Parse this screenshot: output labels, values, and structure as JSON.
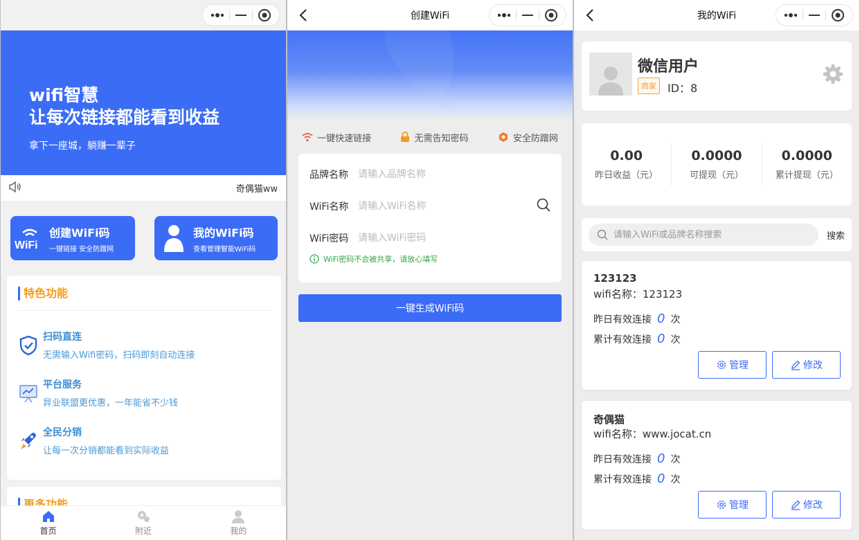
{
  "home": {
    "hero": {
      "line1": "wifi智慧",
      "line2": "让每次链接都能看到收益",
      "sub": "拿下一座城，躺赚一辈子"
    },
    "notice": "奇偶猫ww",
    "quick": [
      {
        "title": "创建WiFi码",
        "sub": "一键链接 安全防蹭网"
      },
      {
        "title": "我的WiFi码",
        "sub": "查看管理智能WiFi码"
      }
    ],
    "features": {
      "title": "特色功能",
      "items": [
        {
          "name": "扫码直连",
          "desc": "无需输入Wifi密码，扫码即刻自动连接",
          "icon": "shield-check-icon"
        },
        {
          "name": "平台服务",
          "desc": "异业联盟更优惠，一年能省不少钱",
          "icon": "chart-board-icon"
        },
        {
          "name": "全民分销",
          "desc": "让每一次分销都能看到实际收益",
          "icon": "rocket-icon"
        }
      ]
    },
    "more_title": "更多功能",
    "tabs": [
      {
        "label": "首页"
      },
      {
        "label": "附近"
      },
      {
        "label": "我的"
      }
    ]
  },
  "create": {
    "title": "创建WiFi",
    "perks": [
      "一键快速链接",
      "无需告知密码",
      "安全防蹭网"
    ],
    "fields": {
      "brand_label": "品牌名称",
      "brand_placeholder": "请输入品牌名称",
      "ssid_label": "WiFi名称",
      "ssid_placeholder": "请输入WiFi名称",
      "pwd_label": "WiFi密码",
      "pwd_placeholder": "请输入WiFi密码"
    },
    "hint": "WiFi密码不会被共享，请放心填写",
    "submit": "一键生成WiFi码"
  },
  "mine": {
    "title": "我的WiFi",
    "user": {
      "name": "微信用户",
      "badge": "商家",
      "id": "ID：8"
    },
    "stats": [
      {
        "value": "0.00",
        "label": "昨日收益（元）"
      },
      {
        "value": "0.0000",
        "label": "可提现（元）"
      },
      {
        "value": "0.0000",
        "label": "累计提现（元）"
      }
    ],
    "search": {
      "placeholder": "请输入WiFi或品牌名称搜索",
      "button": "搜索"
    },
    "wifis": [
      {
        "title": "123123",
        "name": "wifi名称：123123",
        "yesterday_label": "昨日有效连接",
        "yesterday": "0",
        "total_label": "累计有效连接",
        "total": "0",
        "unit": "次",
        "manage": "管理",
        "edit": "修改"
      },
      {
        "title": "奇偶猫",
        "name": "wifi名称：www.jocat.cn",
        "yesterday_label": "昨日有效连接",
        "yesterday": "0",
        "total_label": "累计有效连接",
        "total": "0",
        "unit": "次",
        "manage": "管理",
        "edit": "修改"
      }
    ]
  },
  "colors": {
    "primary": "#3b6cf6",
    "accent": "#f39c1a",
    "hint_green": "#31a84b"
  }
}
